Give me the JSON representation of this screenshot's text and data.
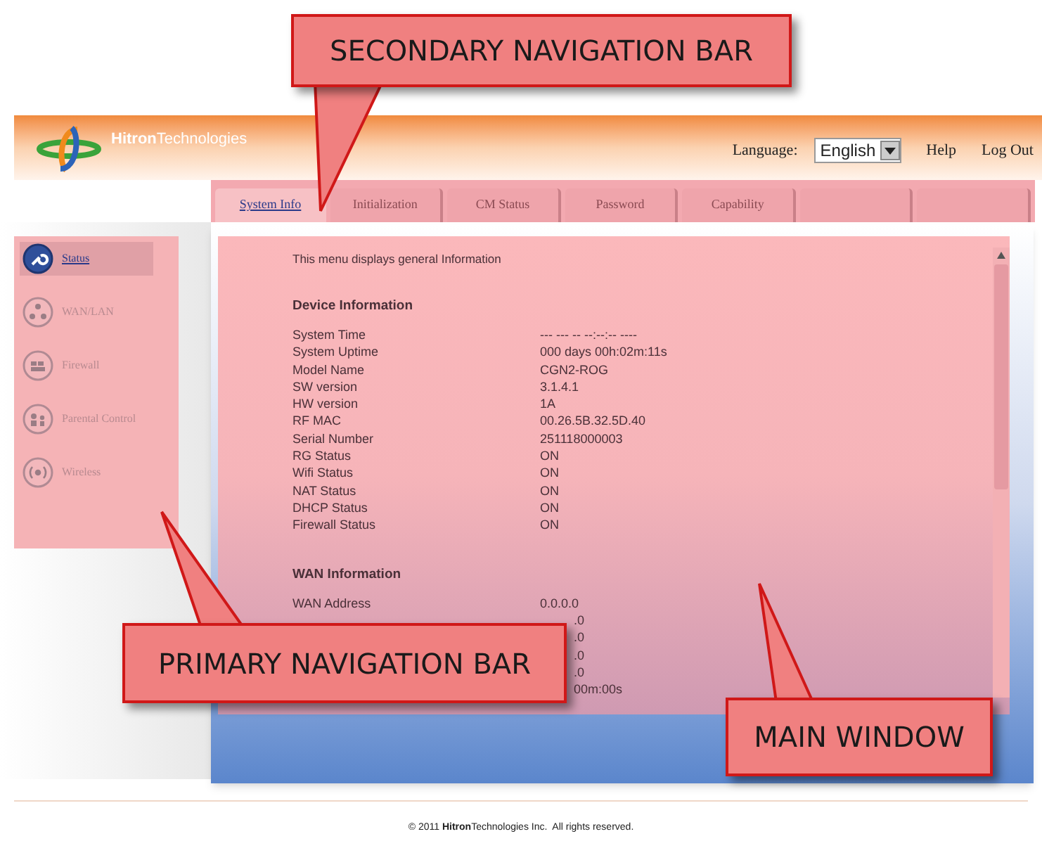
{
  "header": {
    "logo": "**Hitron**Technologies",
    "language_label": "Language:",
    "language_value": "English",
    "links": [
      "Help",
      "Log Out"
    ]
  },
  "tabs": [
    {
      "label": "System Info",
      "selected": true
    },
    {
      "label": "Initialization",
      "selected": false
    },
    {
      "label": "CM Status",
      "selected": false
    },
    {
      "label": "Password",
      "selected": false
    },
    {
      "label": "Capability",
      "selected": false
    },
    {
      "selected": false
    },
    {
      "selected": false
    }
  ],
  "sidebar": {
    "items": [
      {
        "label": "Status",
        "selected": true
      },
      {
        "label": "WAN/LAN",
        "selected": false
      },
      {
        "label": "Firewall",
        "selected": false
      },
      {
        "label": "Parental Control",
        "selected": false
      },
      {
        "label": "Wireless",
        "selected": false
      }
    ]
  },
  "main": {
    "intro": "This menu displays general Information",
    "sections": [
      {
        "title": "Device Information",
        "rows": [
          {
            "label": "System Time",
            "value": "--- --- -- --:--:-- ----"
          },
          {
            "label": "System Uptime",
            "value": "000 days 00h:02m:11s"
          },
          {
            "label": "Model Name",
            "value": "CGN2-ROG"
          },
          {
            "label": "SW version",
            "value": "3.1.4.1"
          },
          {
            "label": "HW version",
            "value": "1A"
          },
          {
            "label": "RF MAC",
            "value": "00.26.5B.32.5D.40"
          },
          {
            "label": "Serial Number",
            "value": "251118000003"
          },
          {
            "label": "RG Status",
            "value": "ON"
          },
          {
            "label": "Wifi Status",
            "value": "ON"
          },
          {
            "label": "NAT Status",
            "value": "ON"
          },
          {
            "label": "DHCP Status",
            "value": "ON"
          },
          {
            "label": "Firewall Status",
            "value": "ON"
          }
        ]
      },
      {
        "title": "WAN Information",
        "rows": [
          {
            "label": "WAN Address",
            "value": "0.0.0.0"
          },
          {
            "value": ".0"
          },
          {
            "value": ".0"
          },
          {
            "value": ".0"
          },
          {
            "value": ".0"
          },
          {
            "value": "00m:00s"
          }
        ]
      }
    ]
  },
  "callouts": [
    {
      "kind": "secondary",
      "text": "SECONDARY NAVIGATION BAR"
    },
    {
      "kind": "primary",
      "text": "PRIMARY NAVIGATION BAR"
    },
    {
      "kind": "main",
      "text": "MAIN WINDOW"
    }
  ],
  "footer": "© 2011 **Hitron**Technologies Inc.  All rights reserved."
}
